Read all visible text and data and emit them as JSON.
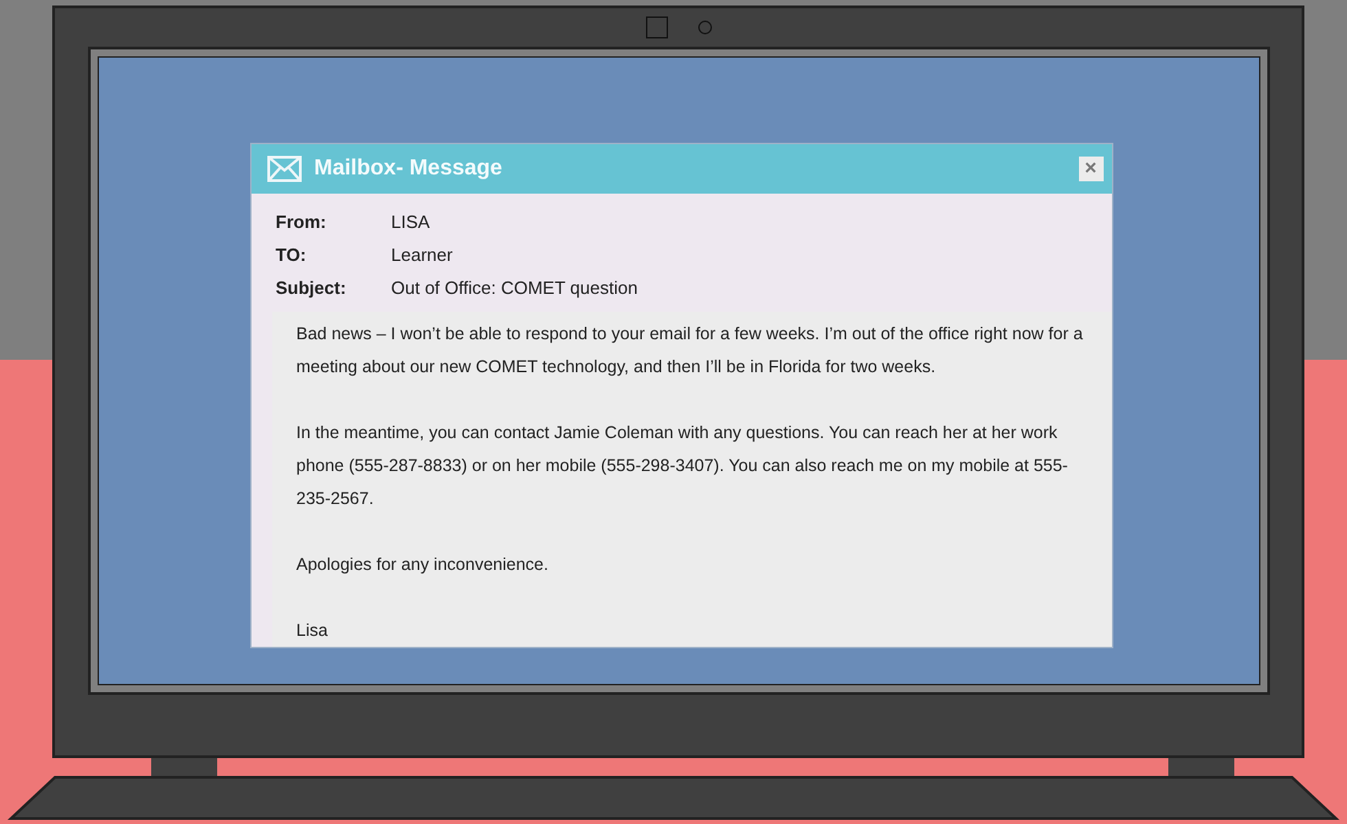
{
  "window": {
    "title": "Mailbox- Message",
    "close": "×"
  },
  "header_fields": [
    {
      "label": "From:",
      "value": "LISA"
    },
    {
      "label": "TO:",
      "value": "Learner"
    },
    {
      "label": "Subject:",
      "value": "Out of Office: COMET question"
    }
  ],
  "body": [
    "Bad news – I won’t be able to respond to your email for a few weeks. I’m out of the office right now for a meeting about our new COMET technology, and then I’ll be in Florida for two weeks.",
    "In the meantime, you can contact Jamie Coleman with any questions. You can reach her at her work phone (555-287-8833) or on her mobile (555-298-3407). You can also reach me on my mobile at 555-235-2567.",
    "Apologies for any inconvenience.",
    "Lisa"
  ]
}
